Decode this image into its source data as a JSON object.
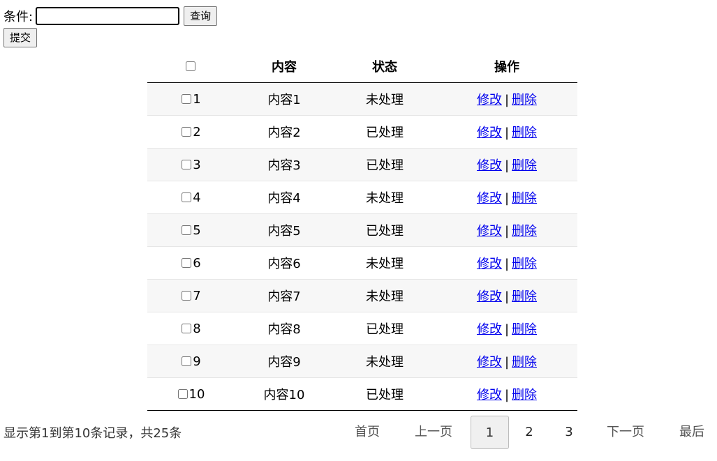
{
  "search": {
    "label": "条件:",
    "value": "",
    "query_button": "查询",
    "submit_button": "提交"
  },
  "table": {
    "headers": [
      "",
      "内容",
      "状态",
      "操作"
    ],
    "edit_label": "修改",
    "delete_label": "删除",
    "separator": "|",
    "rows": [
      {
        "id": "1",
        "content": "内容1",
        "status": "未处理"
      },
      {
        "id": "2",
        "content": "内容2",
        "status": "已处理"
      },
      {
        "id": "3",
        "content": "内容3",
        "status": "已处理"
      },
      {
        "id": "4",
        "content": "内容4",
        "status": "未处理"
      },
      {
        "id": "5",
        "content": "内容5",
        "status": "已处理"
      },
      {
        "id": "6",
        "content": "内容6",
        "status": "未处理"
      },
      {
        "id": "7",
        "content": "内容7",
        "status": "未处理"
      },
      {
        "id": "8",
        "content": "内容8",
        "status": "已处理"
      },
      {
        "id": "9",
        "content": "内容9",
        "status": "未处理"
      },
      {
        "id": "10",
        "content": "内容10",
        "status": "已处理"
      }
    ]
  },
  "footer": {
    "info": "显示第1到第10条记录，共25条"
  },
  "pagination": {
    "first": "首页",
    "prev": "上一页",
    "pages": [
      "1",
      "2",
      "3"
    ],
    "current": "1",
    "next": "下一页",
    "last": "最后"
  }
}
